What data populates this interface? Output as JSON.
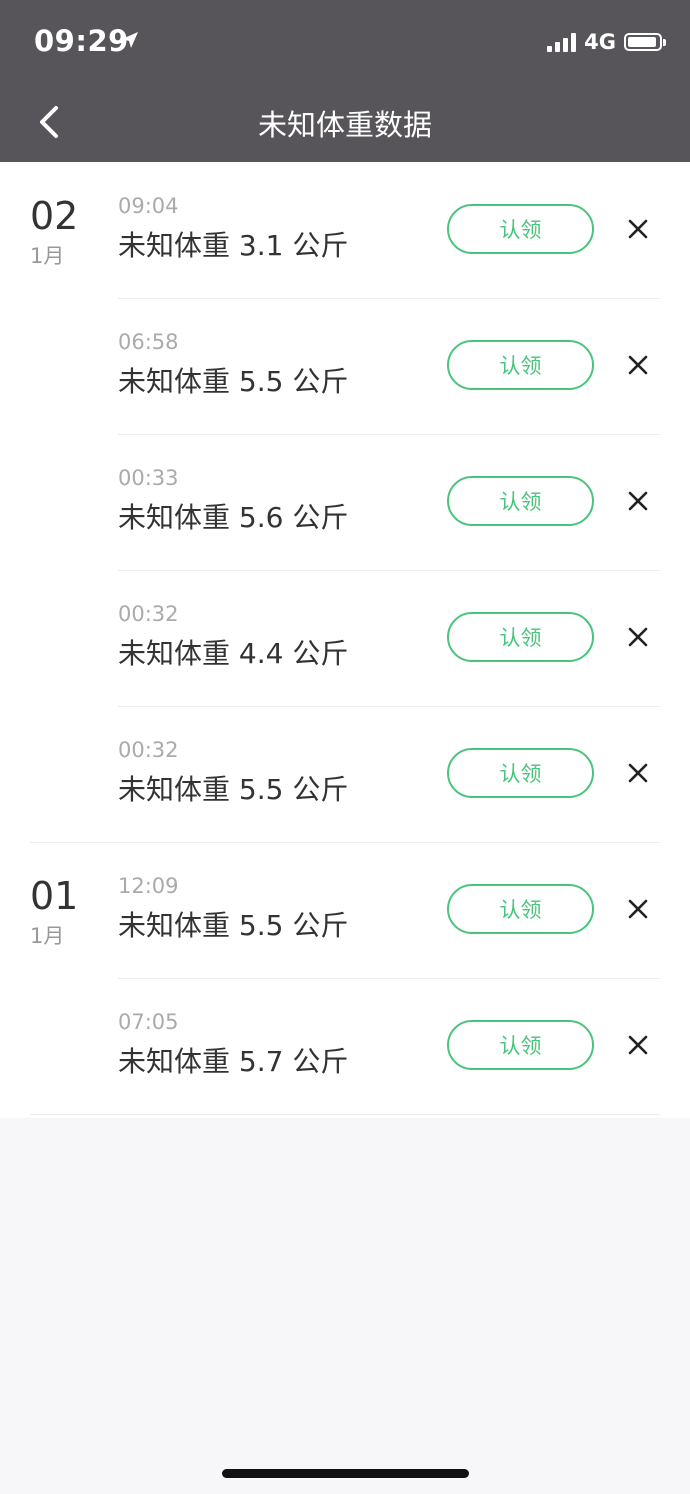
{
  "status_bar": {
    "time": "09:29",
    "network": "4G"
  },
  "header": {
    "title": "未知体重数据"
  },
  "claim_label": "认领",
  "groups": [
    {
      "day": "02",
      "month": "1月",
      "items": [
        {
          "time": "09:04",
          "weight": "未知体重 3.1 公斤"
        },
        {
          "time": "06:58",
          "weight": "未知体重 5.5 公斤"
        },
        {
          "time": "00:33",
          "weight": "未知体重 5.6 公斤"
        },
        {
          "time": "00:32",
          "weight": "未知体重 4.4 公斤"
        },
        {
          "time": "00:32",
          "weight": "未知体重 5.5 公斤"
        }
      ]
    },
    {
      "day": "01",
      "month": "1月",
      "items": [
        {
          "time": "12:09",
          "weight": "未知体重 5.5 公斤"
        },
        {
          "time": "07:05",
          "weight": "未知体重 5.7 公斤"
        }
      ]
    }
  ],
  "colors": {
    "header_bg": "#575559",
    "accent": "#4ac47c"
  }
}
